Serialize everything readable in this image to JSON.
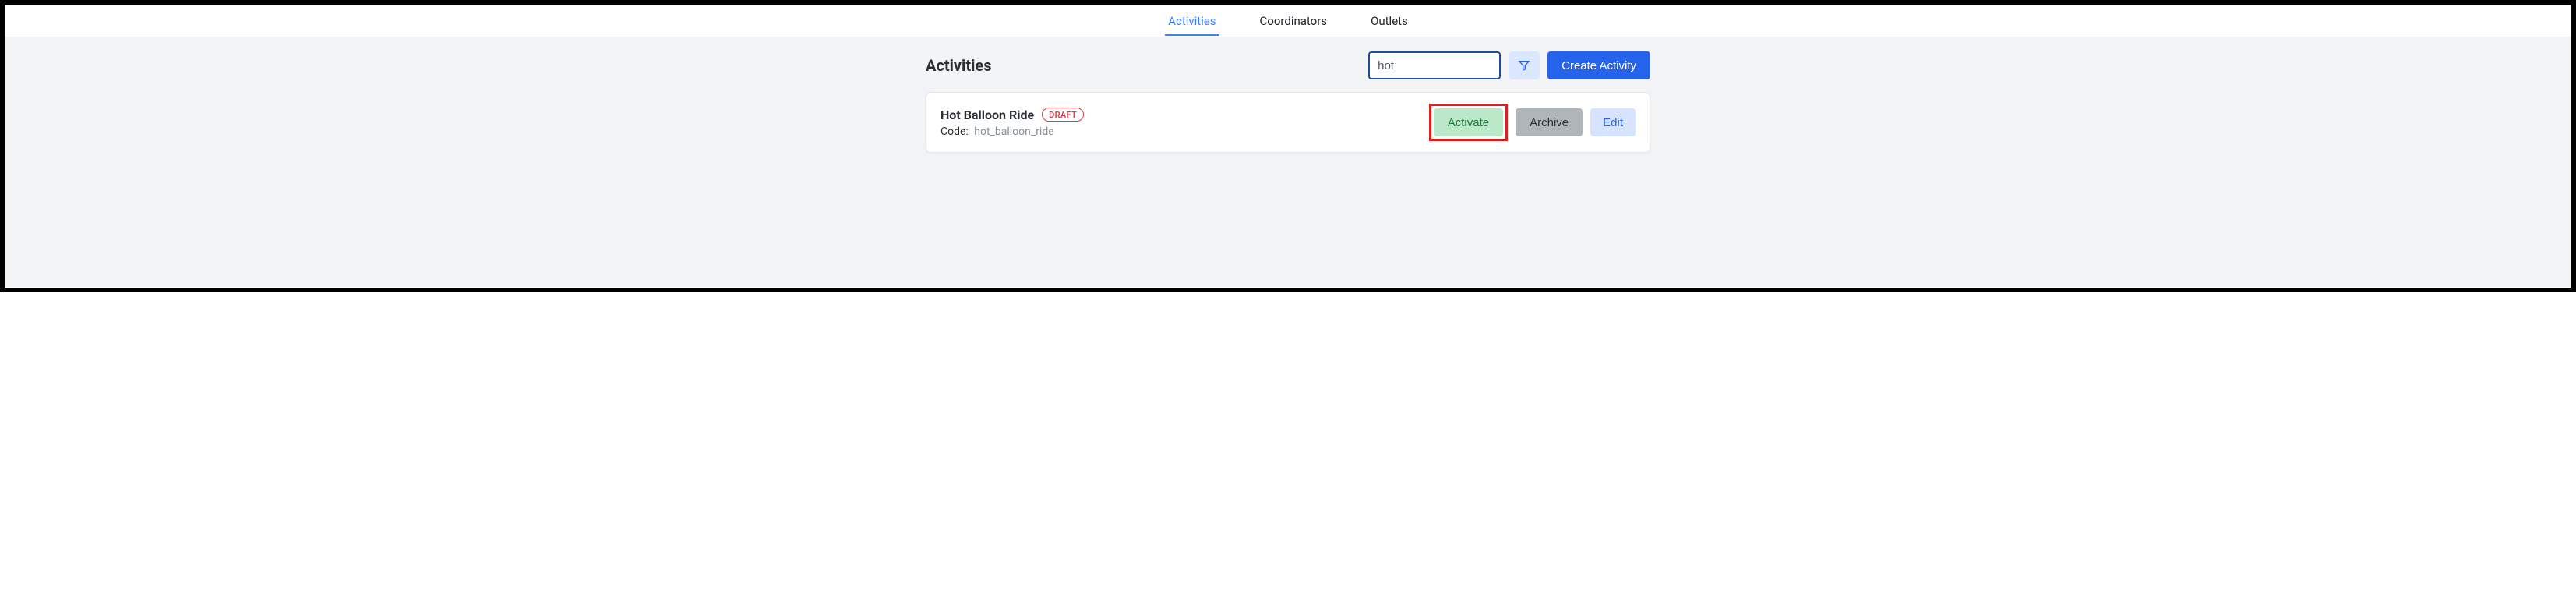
{
  "nav": {
    "items": [
      {
        "label": "Activities",
        "active": true
      },
      {
        "label": "Coordinators",
        "active": false
      },
      {
        "label": "Outlets",
        "active": false
      }
    ]
  },
  "page": {
    "title": "Activities"
  },
  "search": {
    "value": "hot",
    "placeholder": ""
  },
  "buttons": {
    "create": "Create Activity",
    "activate": "Activate",
    "archive": "Archive",
    "edit": "Edit"
  },
  "item": {
    "title": "Hot Balloon Ride",
    "badge": "DRAFT",
    "code_label": "Code:",
    "code_value": "hot_balloon_ride"
  }
}
